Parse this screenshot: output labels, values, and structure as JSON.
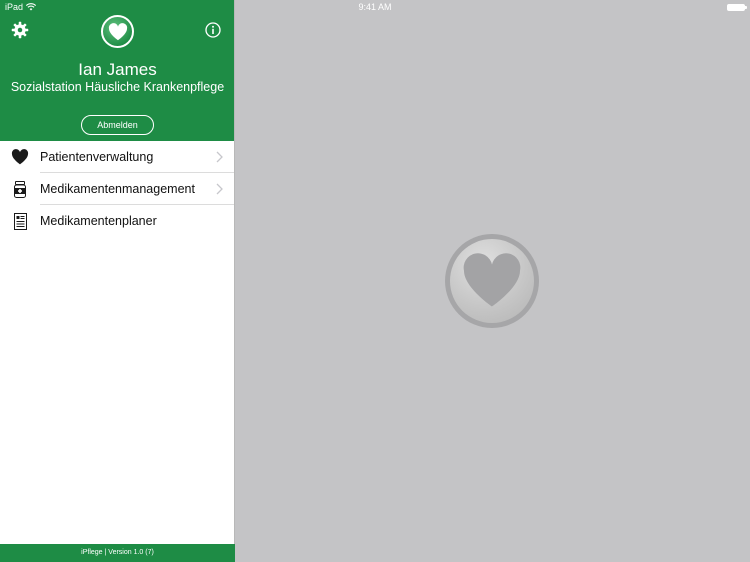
{
  "statusbar": {
    "carrier": "iPad",
    "time": "9:41 AM"
  },
  "user": {
    "name": "Ian James",
    "organization": "Sozialstation Häusliche Krankenpflege"
  },
  "logout_label": "Abmelden",
  "menu": [
    {
      "label": "Patientenverwaltung",
      "icon": "heart-icon"
    },
    {
      "label": "Medikamentenmanagement",
      "icon": "medication-bottle-icon"
    },
    {
      "label": "Medikamentenplaner",
      "icon": "document-icon"
    }
  ],
  "footer": "iPflege | Version 1.0 (7)",
  "colors": {
    "brand": "#1e8c45",
    "detail_background": "#c4c4c6"
  }
}
